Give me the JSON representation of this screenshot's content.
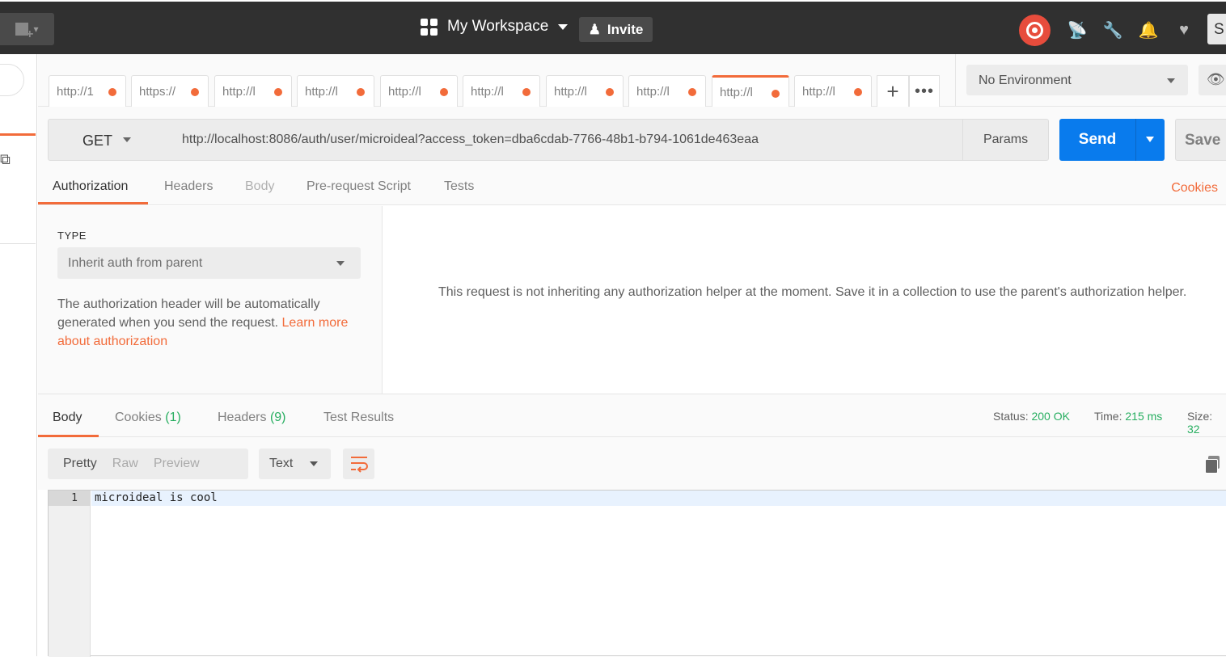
{
  "topbar": {
    "workspace_label": "My Workspace",
    "invite_label": "Invite",
    "user_initial": "S"
  },
  "tabs": [
    {
      "label": "http://1",
      "active": false
    },
    {
      "label": "https://",
      "active": false
    },
    {
      "label": "http://l",
      "active": false
    },
    {
      "label": "http://l",
      "active": false
    },
    {
      "label": "http://l",
      "active": false
    },
    {
      "label": "http://l",
      "active": false
    },
    {
      "label": "http://l",
      "active": false
    },
    {
      "label": "http://l",
      "active": false
    },
    {
      "label": "http://l",
      "active": true
    },
    {
      "label": "http://l",
      "active": false
    }
  ],
  "environment": {
    "selected": "No Environment"
  },
  "request": {
    "method": "GET",
    "url": "http://localhost:8086/auth/user/microideal?access_token=dba6cdab-7766-48b1-b794-1061de463eaa",
    "params_label": "Params",
    "send_label": "Send",
    "save_label": "Save"
  },
  "request_tabs": {
    "authorization": "Authorization",
    "headers": "Headers",
    "body": "Body",
    "prerequest": "Pre-request Script",
    "tests": "Tests",
    "cookies": "Cookies"
  },
  "auth": {
    "type_label": "TYPE",
    "type_value": "Inherit auth from parent",
    "desc_text": "The authorization header will be automatically generated when you send the request. ",
    "desc_link": "Learn more about authorization",
    "message": "This request is not inheriting any authorization helper at the moment. Save it in a collection to use the parent's authorization helper."
  },
  "response_tabs": {
    "body": "Body",
    "cookies": "Cookies",
    "cookies_count": "(1)",
    "headers": "Headers",
    "headers_count": "(9)",
    "test_results": "Test Results"
  },
  "response_meta": {
    "status_label": "Status:",
    "status_value": "200 OK",
    "time_label": "Time:",
    "time_value": "215 ms",
    "size_label": "Size:",
    "size_value": "32"
  },
  "view": {
    "pretty": "Pretty",
    "raw": "Raw",
    "preview": "Preview",
    "format": "Text"
  },
  "editor": {
    "line_number": "1",
    "line_text": "microideal is cool"
  },
  "colors": {
    "accent": "#f26b3a",
    "send": "#097bed",
    "status_ok": "#27ae60",
    "topbar": "#303030"
  }
}
